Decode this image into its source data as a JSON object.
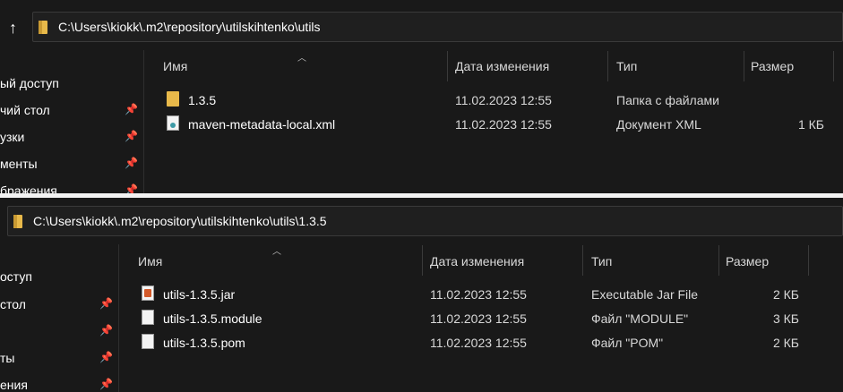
{
  "top": {
    "path": "C:\\Users\\kiokk\\.m2\\repository\\utilskihtenko\\utils",
    "sidebar": [
      "ый доступ",
      "чий стол",
      "узки",
      "менты",
      "бражения"
    ],
    "columns": {
      "name": "Имя",
      "date": "Дата изменения",
      "type": "Тип",
      "size": "Размер"
    },
    "rows": [
      {
        "name": "1.3.5",
        "date": "11.02.2023 12:55",
        "type": "Папка с файлами",
        "size": "",
        "icon": "folder-icon"
      },
      {
        "name": "maven-metadata-local.xml",
        "date": "11.02.2023 12:55",
        "type": "Документ XML",
        "size": "1 КБ",
        "icon": "xml-file-icon"
      }
    ]
  },
  "bottom": {
    "path": "C:\\Users\\kiokk\\.m2\\repository\\utilskihtenko\\utils\\1.3.5",
    "sidebar": [
      "оступ",
      "стол",
      "",
      "ты",
      "ения"
    ],
    "columns": {
      "name": "Имя",
      "date": "Дата изменения",
      "type": "Тип",
      "size": "Размер"
    },
    "rows": [
      {
        "name": "utils-1.3.5.jar",
        "date": "11.02.2023 12:55",
        "type": "Executable Jar File",
        "size": "2 КБ",
        "icon": "jar-file-icon"
      },
      {
        "name": "utils-1.3.5.module",
        "date": "11.02.2023 12:55",
        "type": "Файл \"MODULE\"",
        "size": "3 КБ",
        "icon": "file-icon"
      },
      {
        "name": "utils-1.3.5.pom",
        "date": "11.02.2023 12:55",
        "type": "Файл \"POM\"",
        "size": "2 КБ",
        "icon": "file-icon"
      }
    ]
  }
}
